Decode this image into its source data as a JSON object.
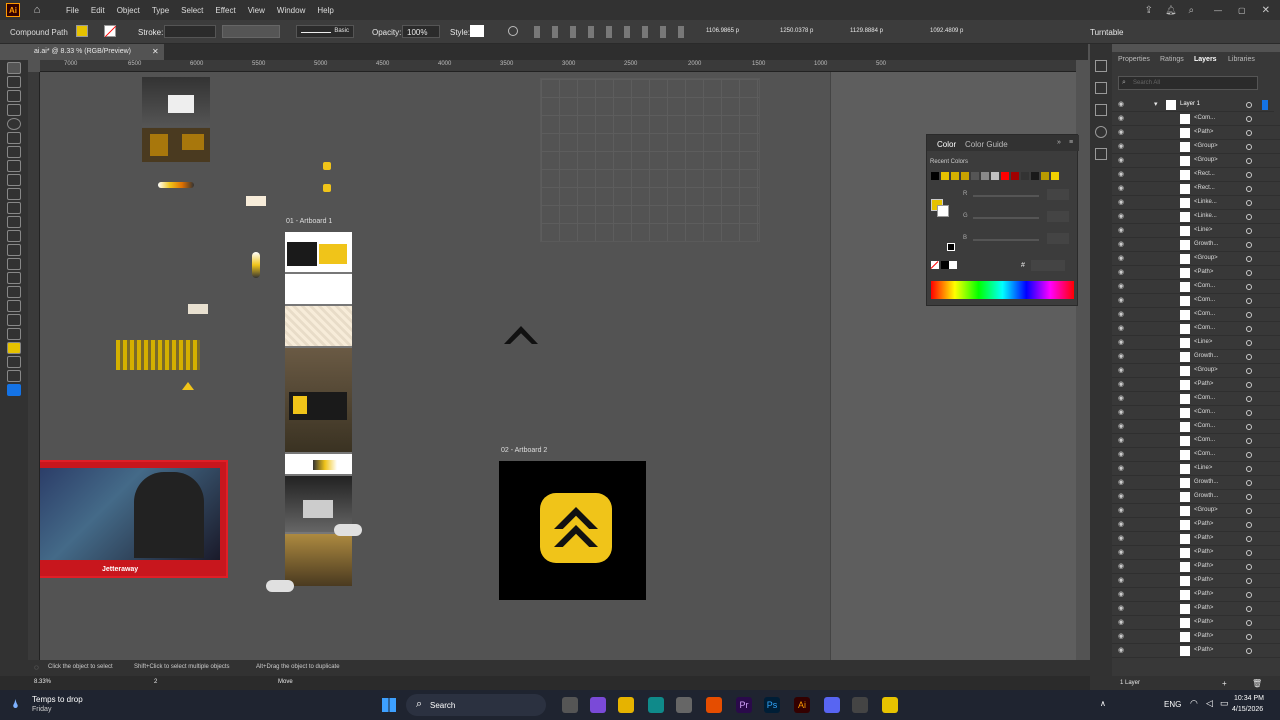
{
  "menu": [
    "File",
    "Edit",
    "Object",
    "Type",
    "Select",
    "Effect",
    "View",
    "Window",
    "Help"
  ],
  "control": {
    "selection_type": "Compound Path",
    "stroke_label": "Stroke:",
    "brush": "Basic",
    "opacity_label": "Opacity:",
    "opacity_value": "100%",
    "style_label": "Style:",
    "x_value": "1106.9865 p",
    "y_value": "1250.0378 p",
    "w_value": "1129.8884 p",
    "h_value": "1092.4809 p",
    "turntable": "Turntable"
  },
  "document_tab": {
    "name": "ai.ai* @ 8.33 % (RGB/Preview)"
  },
  "ruler_ticks": [
    "7000",
    "6500",
    "6000",
    "5500",
    "5000",
    "4500",
    "4000",
    "3500",
    "3000",
    "2500",
    "2000",
    "1500",
    "1000",
    "500"
  ],
  "artboards": [
    {
      "label": "01 - Artboard 1"
    },
    {
      "label": "02 - Artboard 2"
    }
  ],
  "overlay_text": "Jetteraway",
  "color_panel": {
    "tabs": [
      "Color",
      "Color Guide"
    ],
    "recent_label": "Recent Colors",
    "channels": [
      "R",
      "G",
      "B"
    ],
    "hex_label": "#",
    "recent": [
      "#000000",
      "#e6c200",
      "#d4b000",
      "#c8a300",
      "#555555",
      "#8a8a8a",
      "#c0c0c0",
      "#ff0000",
      "#a00000",
      "#333333",
      "#1a1a1a",
      "#b89a00",
      "#ccad00",
      "#f0d000",
      "#b0b0b0",
      "#e8c300"
    ]
  },
  "right_tabs": [
    "Properties",
    "Ratings",
    "Layers",
    "Libraries"
  ],
  "layers": {
    "search_placeholder": "Search All",
    "top_layer": "Layer 1",
    "items": [
      "<Com...",
      "<Path>",
      "<Group>",
      "<Group>",
      "<Rect...",
      "<Rect...",
      "<Linke...",
      "<Linke...",
      "<Line>",
      "Growth...",
      "<Group>",
      "<Path>",
      "<Com...",
      "<Com...",
      "<Com...",
      "<Com...",
      "<Line>",
      "Growth...",
      "<Group>",
      "<Path>",
      "<Com...",
      "<Com...",
      "<Com...",
      "<Com...",
      "<Com...",
      "<Line>",
      "Growth...",
      "Growth...",
      "<Group>",
      "<Path>",
      "<Path>",
      "<Path>",
      "<Path>",
      "<Path>",
      "<Path>",
      "<Path>",
      "<Path>",
      "<Path>",
      "<Path>"
    ],
    "footer": "1 Layer"
  },
  "status": {
    "zoom": "8.33%",
    "artboard_num": "2",
    "tool": "Move",
    "hint1": "Click the object to select",
    "hint2": "Shift+Click to select multiple objects",
    "hint3": "Alt+Drag the object to duplicate"
  },
  "taskbar": {
    "weather": "Temps to drop",
    "weather_day": "Friday",
    "search": "Search",
    "lang": "ENG",
    "time": "10:34 PM",
    "date": "4/15/2026"
  },
  "colors": {
    "brand_yellow": "#f0c419",
    "accent_blue": "#1473e6"
  }
}
